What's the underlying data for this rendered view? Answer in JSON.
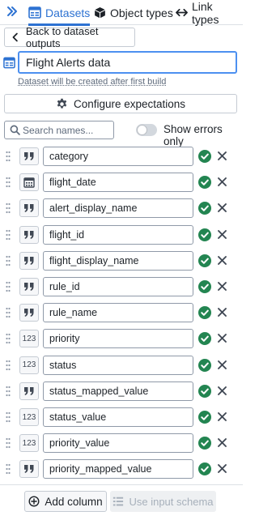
{
  "tabs": [
    {
      "label": "Datasets",
      "active": true,
      "icon": "dataset-icon"
    },
    {
      "label": "Object types",
      "active": false,
      "icon": "cube-icon"
    },
    {
      "label": "Link types",
      "active": false,
      "icon": "arrows-horizontal-icon"
    }
  ],
  "back_button": {
    "label": "Back to dataset outputs"
  },
  "dataset": {
    "name": "Flight Alerts data",
    "hint": "Dataset will be created after first build"
  },
  "configure_button": {
    "label": "Configure expectations"
  },
  "search": {
    "placeholder": "Search names...",
    "value": ""
  },
  "show_errors": {
    "label": "Show errors only",
    "enabled": false
  },
  "columns": [
    {
      "type": "string",
      "type_label": "99",
      "name": "category"
    },
    {
      "type": "date",
      "type_label": "calendar",
      "name": "flight_date"
    },
    {
      "type": "string",
      "type_label": "99",
      "name": "alert_display_name"
    },
    {
      "type": "string",
      "type_label": "99",
      "name": "flight_id"
    },
    {
      "type": "string",
      "type_label": "99",
      "name": "flight_display_name"
    },
    {
      "type": "string",
      "type_label": "99",
      "name": "rule_id"
    },
    {
      "type": "string",
      "type_label": "99",
      "name": "rule_name"
    },
    {
      "type": "number",
      "type_label": "123",
      "name": "priority"
    },
    {
      "type": "number",
      "type_label": "123",
      "name": "status"
    },
    {
      "type": "string",
      "type_label": "99",
      "name": "status_mapped_value"
    },
    {
      "type": "number",
      "type_label": "123",
      "name": "status_value"
    },
    {
      "type": "number",
      "type_label": "123",
      "name": "priority_value"
    },
    {
      "type": "string",
      "type_label": "99",
      "name": "priority_mapped_value"
    }
  ],
  "bottom": {
    "add_column_label": "Add column",
    "use_schema_label": "Use input schema",
    "use_schema_disabled": true
  },
  "colors": {
    "accent": "#2d72d2",
    "success": "#238551"
  }
}
